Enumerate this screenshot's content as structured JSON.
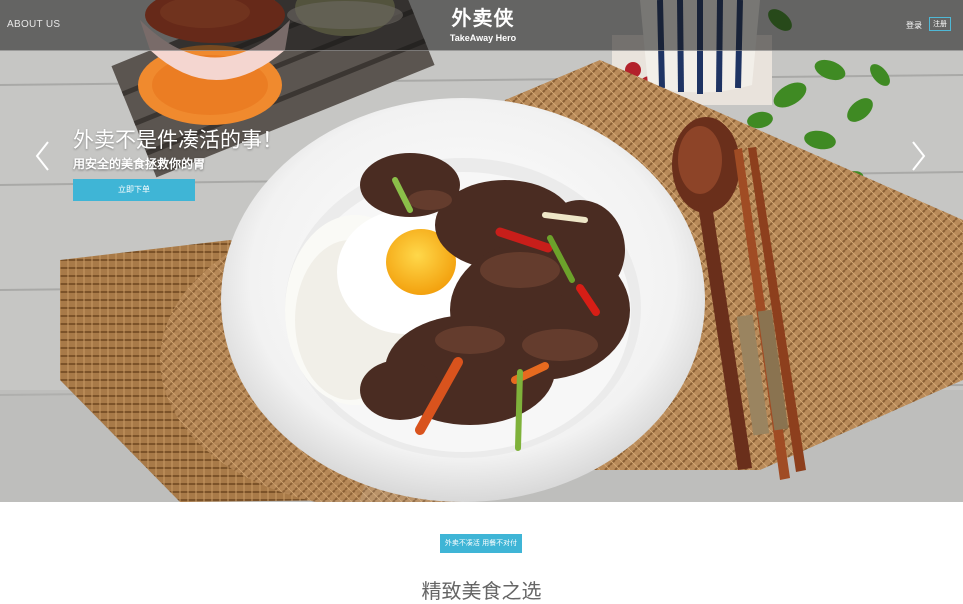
{
  "nav": {
    "about": "ABOUT US",
    "logo_cn": "外卖侠",
    "logo_en": "TakeAway Hero",
    "login": "登录",
    "register": "注册"
  },
  "hero": {
    "title": "外卖不是件凑活的事！",
    "subtitle": "用安全的美食拯救你的胃",
    "order_button": "立即下单",
    "prev_icon": "chevron-left-icon",
    "next_icon": "chevron-right-icon"
  },
  "section": {
    "tag_button": "外卖不凑活 用餐不对付",
    "title": "精致美食之选"
  },
  "colors": {
    "accent": "#3fb5d6",
    "title_gray": "#666666"
  }
}
